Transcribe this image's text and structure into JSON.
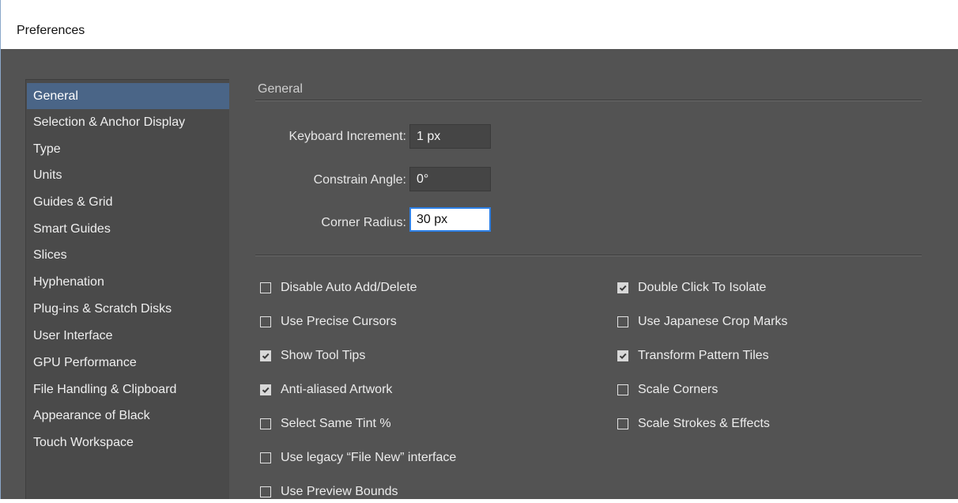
{
  "window": {
    "title": "Preferences"
  },
  "sidebar": {
    "items": [
      {
        "label": "General",
        "selected": true
      },
      {
        "label": "Selection & Anchor Display",
        "selected": false
      },
      {
        "label": "Type",
        "selected": false
      },
      {
        "label": "Units",
        "selected": false
      },
      {
        "label": "Guides & Grid",
        "selected": false
      },
      {
        "label": "Smart Guides",
        "selected": false
      },
      {
        "label": "Slices",
        "selected": false
      },
      {
        "label": "Hyphenation",
        "selected": false
      },
      {
        "label": "Plug-ins & Scratch Disks",
        "selected": false
      },
      {
        "label": "User Interface",
        "selected": false
      },
      {
        "label": "GPU Performance",
        "selected": false
      },
      {
        "label": "File Handling & Clipboard",
        "selected": false
      },
      {
        "label": "Appearance of Black",
        "selected": false
      },
      {
        "label": "Touch Workspace",
        "selected": false
      }
    ]
  },
  "general": {
    "section_title": "General",
    "keyboard_increment": {
      "label": "Keyboard Increment:",
      "value": "1 px"
    },
    "constrain_angle": {
      "label": "Constrain Angle:",
      "value": "0°"
    },
    "corner_radius": {
      "label": "Corner Radius:",
      "value": "30 px"
    },
    "left_options": [
      {
        "label": "Disable Auto Add/Delete",
        "checked": false
      },
      {
        "label": "Use Precise Cursors",
        "checked": false
      },
      {
        "label": "Show Tool Tips",
        "checked": true
      },
      {
        "label": "Anti-aliased Artwork",
        "checked": true
      },
      {
        "label": "Select Same Tint %",
        "checked": false
      },
      {
        "label": "Use legacy “File New” interface",
        "checked": false
      },
      {
        "label": "Use Preview Bounds",
        "checked": false
      }
    ],
    "right_options": [
      {
        "label": "Double Click To Isolate",
        "checked": true
      },
      {
        "label": "Use Japanese Crop Marks",
        "checked": false
      },
      {
        "label": "Transform Pattern Tiles",
        "checked": true
      },
      {
        "label": "Scale Corners",
        "checked": false
      },
      {
        "label": "Scale Strokes & Effects",
        "checked": false
      }
    ]
  },
  "colors": {
    "panel": "#535353",
    "sidebar": "#4a4a4a",
    "selection": "#4a6587",
    "focus": "#2d80e6"
  }
}
